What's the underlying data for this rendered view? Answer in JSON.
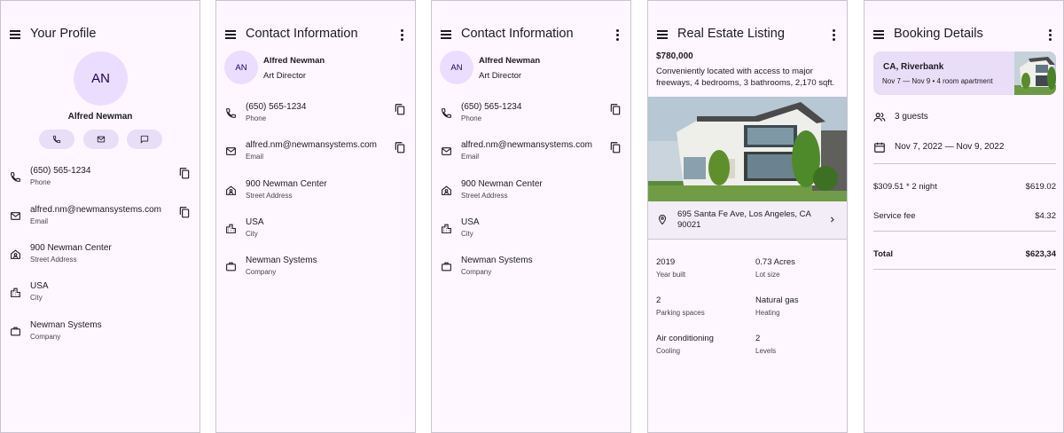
{
  "profile": {
    "title": "Your Profile",
    "initials": "AN",
    "name": "Alfred Newman",
    "rows": [
      {
        "primary": "(650) 565-1234",
        "secondary": "Phone"
      },
      {
        "primary": "alfred.nm@newmansystems.com",
        "secondary": "Email"
      },
      {
        "primary": "900 Newman Center",
        "secondary": "Street Address"
      },
      {
        "primary": "USA",
        "secondary": "City"
      },
      {
        "primary": "Newman Systems",
        "secondary": "Company"
      }
    ]
  },
  "contact": {
    "title": "Contact Information",
    "initials": "AN",
    "name": "Alfred Newman",
    "role": "Art Director",
    "rows": [
      {
        "primary": "(650) 565-1234",
        "secondary": "Phone"
      },
      {
        "primary": "alfred.nm@newmansystems.com",
        "secondary": "Email"
      },
      {
        "primary": "900 Newman Center",
        "secondary": "Street Address"
      },
      {
        "primary": "USA",
        "secondary": "City"
      },
      {
        "primary": "Newman Systems",
        "secondary": "Company"
      }
    ]
  },
  "listing": {
    "title": "Real Estate Listing",
    "price": "$780,000",
    "description": "Conveniently located with access to major freeways, 4 bedrooms, 3 bathrooms, 2,170 sqft.",
    "address": "695 Santa Fe Ave, Los Angeles, CA 90021",
    "specs": [
      {
        "value": "2019",
        "label": "Year built"
      },
      {
        "value": "0.73 Acres",
        "label": "Lot size"
      },
      {
        "value": "2",
        "label": "Parking spaces"
      },
      {
        "value": "Natural gas",
        "label": "Heating"
      },
      {
        "value": "Air conditioning",
        "label": "Cooling"
      },
      {
        "value": "2",
        "label": "Levels"
      }
    ]
  },
  "booking": {
    "title": "Booking Details",
    "city": "CA, Riverbank",
    "dates_summary": "Nov 7 — Nov 9 • 4 room apartment",
    "guests": "3 guests",
    "date_range": "Nov 7, 2022 — Nov 9, 2022",
    "nightly_label": "$309.51 * 2 night",
    "nightly_amount": "$619.02",
    "service_label": "Service fee",
    "service_amount": "$4.32",
    "total_label": "Total",
    "total_amount": "$623,34"
  },
  "icons": {
    "menu": "menu-icon",
    "more": "more-vert-icon",
    "phone": "phone-icon",
    "email": "email-icon",
    "message": "message-icon",
    "home": "home-icon",
    "city": "city-icon",
    "company": "briefcase-icon",
    "copy": "copy-icon",
    "pin": "location-pin-icon",
    "chevron": "chevron-right-icon",
    "guests": "people-icon",
    "calendar": "calendar-icon"
  },
  "colors": {
    "surface": "#fef7ff",
    "avatar": "#eaddff",
    "tonal": "#e8def8",
    "border": "#cac4d0"
  }
}
